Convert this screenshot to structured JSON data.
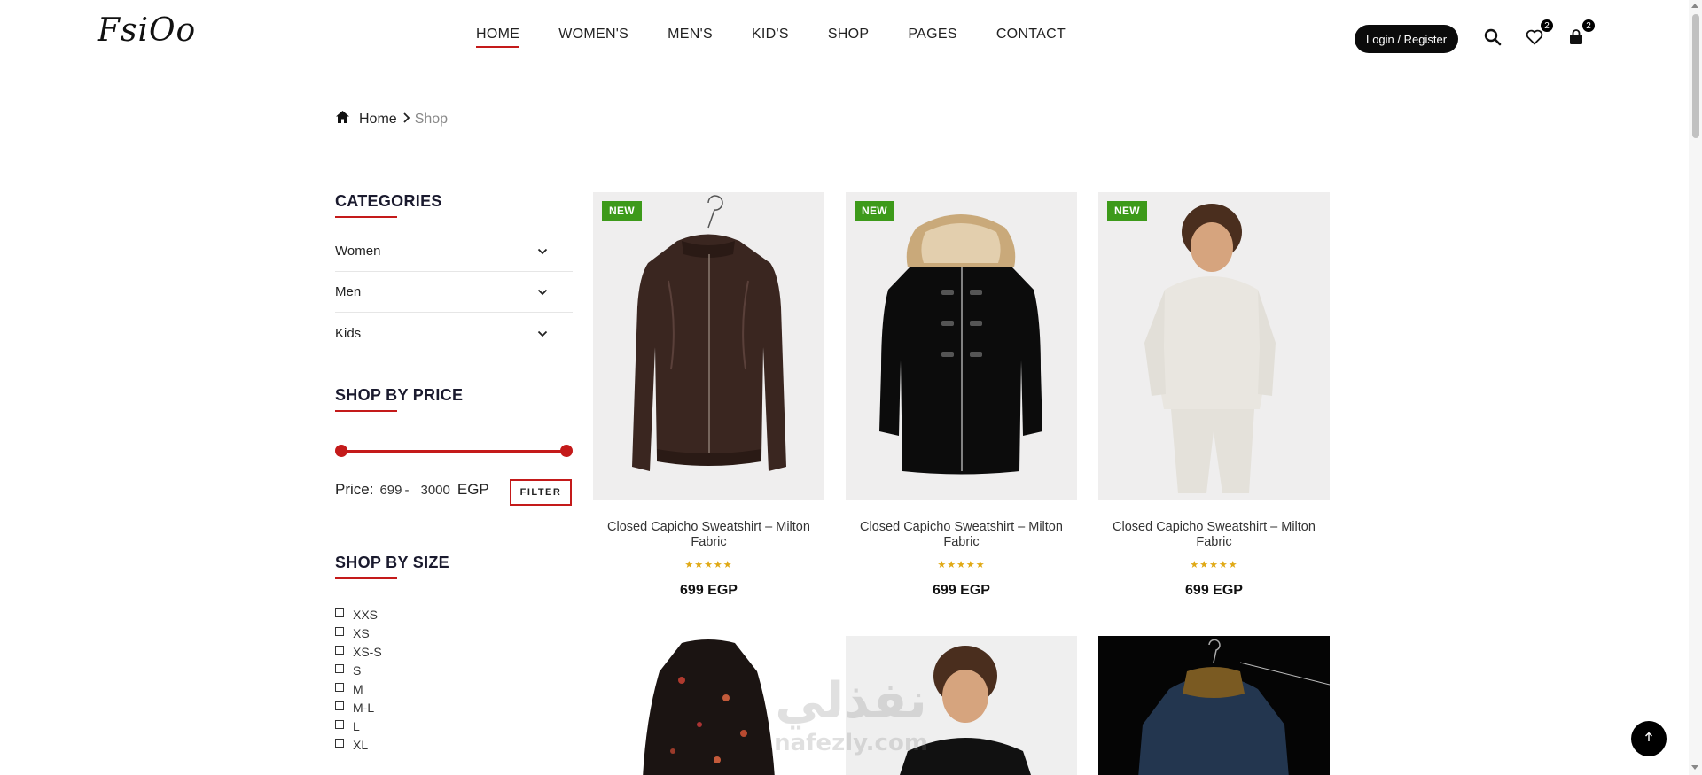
{
  "header": {
    "logo": "FsiOo",
    "nav": [
      "HOME",
      "WOMEN'S",
      "MEN'S",
      "KID'S",
      "SHOP",
      "PAGES",
      "CONTACT"
    ],
    "login_label": "Login / Register",
    "wishlist_count": "2",
    "cart_count": "2"
  },
  "breadcrumb": {
    "home": "Home",
    "current": "Shop"
  },
  "sidebar": {
    "categories_title": "CATEGORIES",
    "categories": [
      "Women",
      "Men",
      "Kids"
    ],
    "price_title": "SHOP BY PRICE",
    "price_label": "Price:",
    "price_min": "699",
    "price_sep": "-",
    "price_max": "3000",
    "currency": "EGP",
    "filter_label": "FILTER",
    "size_title": "SHOP BY SIZE",
    "sizes": [
      "XXS",
      "XS",
      "XS-S",
      "S",
      "M",
      "M-L",
      "L",
      "XL"
    ]
  },
  "products": [
    {
      "badge": "NEW",
      "title": "Closed Capicho Sweatshirt – Milton Fabric",
      "stars": "★★★★★",
      "price": "699 EGP"
    },
    {
      "badge": "NEW",
      "title": "Closed Capicho Sweatshirt – Milton Fabric",
      "stars": "★★★★★",
      "price": "699 EGP"
    },
    {
      "badge": "NEW",
      "title": "Closed Capicho Sweatshirt – Milton Fabric",
      "stars": "★★★★★",
      "price": "699 EGP"
    }
  ],
  "watermark": {
    "arabic": "نفذلي",
    "latin": "nafezly.com"
  },
  "colors": {
    "accent": "#c41a1a",
    "badge_green": "#3d9a1a",
    "star": "#e0a915"
  }
}
